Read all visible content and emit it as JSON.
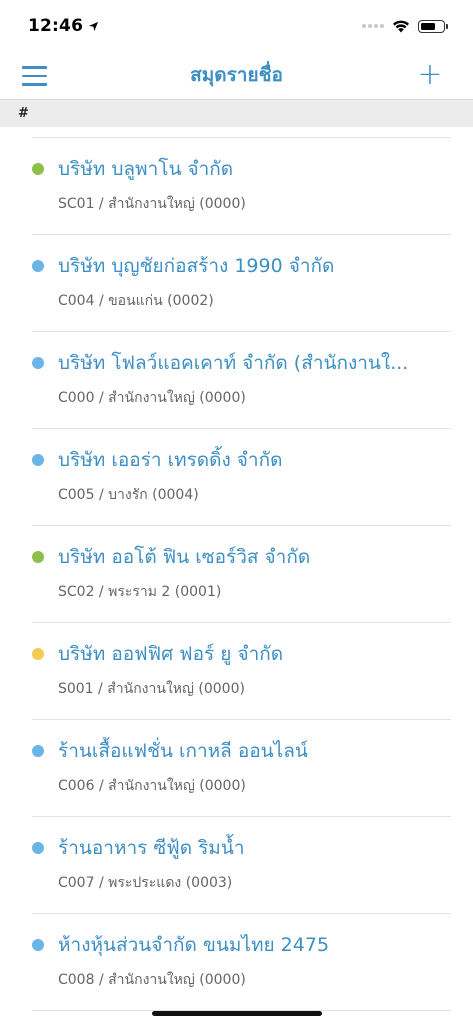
{
  "status_bar": {
    "time": "12:46",
    "location_icon": "location-arrow-icon",
    "signal_icon": "signal-dots-icon",
    "wifi_icon": "wifi-icon",
    "battery_icon": "battery-icon"
  },
  "nav": {
    "title": "สมุดรายชื่อ",
    "menu_icon": "hamburger-menu-icon",
    "add_label": "+"
  },
  "section": {
    "header": "#"
  },
  "colors": {
    "accent": "#3d8fc4",
    "green": "#8dc04a",
    "blue": "#6ab4e8",
    "yellow": "#f2cc55"
  },
  "contacts": [
    {
      "name": "บริษัท บลูพาโน จำกัด",
      "sub": "SC01 / สำนักงานใหญ่ (0000)",
      "dot": "#8dc04a"
    },
    {
      "name": "บริษัท บุญชัยก่อสร้าง 1990 จำกัด",
      "sub": "C004 / ขอนแก่น (0002)",
      "dot": "#6ab4e8"
    },
    {
      "name": "บริษัท โฟลว์แอคเคาท์ จำกัด (สำนักงานใ...",
      "sub": "C000 / สำนักงานใหญ่ (0000)",
      "dot": "#6ab4e8"
    },
    {
      "name": "บริษัท เออร่า เทรดดิ้ง จำกัด",
      "sub": "C005 / บางรัก (0004)",
      "dot": "#6ab4e8"
    },
    {
      "name": "บริษัท ออโต้ ฟิน เซอร์วิส จำกัด",
      "sub": "SC02 / พระราม 2 (0001)",
      "dot": "#8dc04a"
    },
    {
      "name": "บริษัท ออฟฟิศ ฟอร์ ยู จำกัด",
      "sub": "S001 / สำนักงานใหญ่ (0000)",
      "dot": "#f2cc55"
    },
    {
      "name": "ร้านเสื้อแฟชั่น เกาหลี ออนไลน์",
      "sub": "C006 / สำนักงานใหญ่ (0000)",
      "dot": "#6ab4e8"
    },
    {
      "name": "ร้านอาหาร ซีฟู้ด ริมน้ำ",
      "sub": "C007 / พระประแดง (0003)",
      "dot": "#6ab4e8"
    },
    {
      "name": "ห้างหุ้นส่วนจำกัด ขนมไทย 2475",
      "sub": "C008 / สำนักงานใหญ่ (0000)",
      "dot": "#6ab4e8"
    }
  ]
}
